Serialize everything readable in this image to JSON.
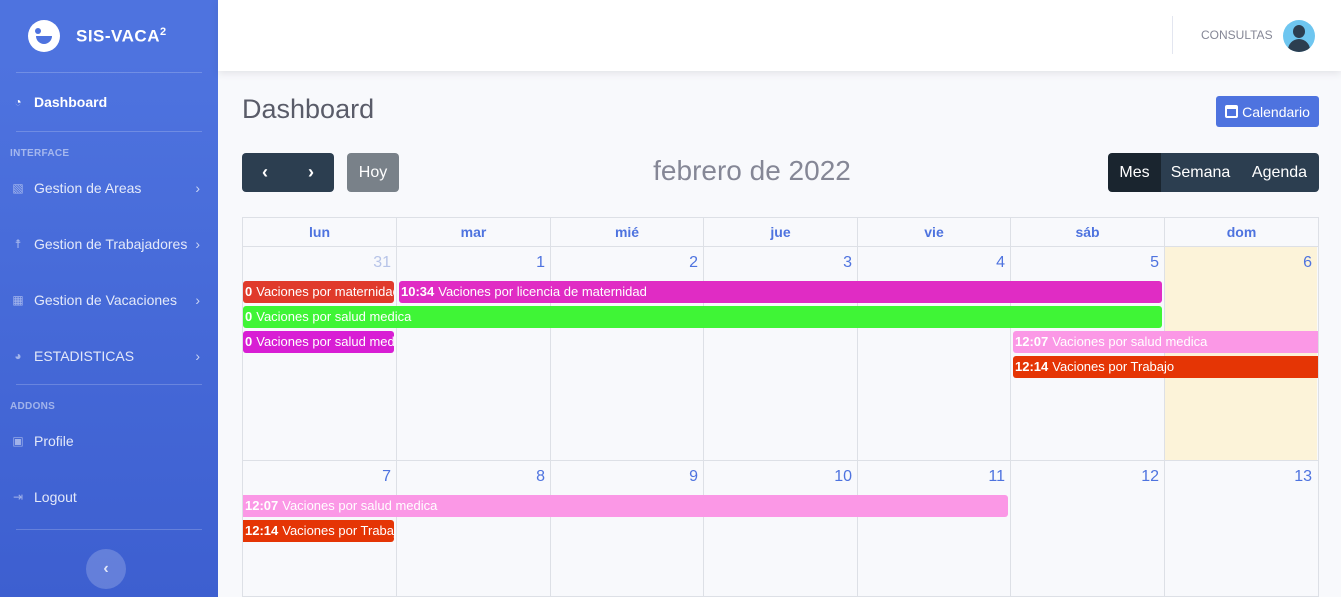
{
  "sidebar": {
    "brand": "SIS-VACA",
    "brand_sup": "2",
    "dashboard": "Dashboard",
    "heading_interface": "INTERFACE",
    "areas": "Gestion de Areas",
    "trabajadores": "Gestion de Trabajadores",
    "vacaciones": "Gestion de Vacaciones",
    "estadisticas": "ESTADISTICAS",
    "heading_addons": "ADDONS",
    "profile": "Profile",
    "logout": "Logout"
  },
  "topbar": {
    "user": "CONSULTAS"
  },
  "page": {
    "title": "Dashboard",
    "calendar_button": "Calendario"
  },
  "calendar": {
    "title": "febrero de 2022",
    "today_button": "Hoy",
    "views": [
      "Mes",
      "Semana",
      "Agenda"
    ],
    "active_view": "Mes",
    "weekdays": [
      "lun",
      "mar",
      "mié",
      "jue",
      "vie",
      "sáb",
      "dom"
    ],
    "weeks": [
      {
        "days": [
          "31",
          "1",
          "2",
          "3",
          "4",
          "5",
          "6"
        ]
      },
      {
        "days": [
          "7",
          "8",
          "9",
          "10",
          "11",
          "12",
          "13"
        ]
      }
    ],
    "colors": {
      "red": "#e03a2b",
      "magenta": "#e02cc4",
      "green": "#3ff536",
      "purple": "#d81ed4",
      "pink": "#fb98e6",
      "orange": "#e53505",
      "today_bg": "#fcf3d9"
    },
    "events_week1": [
      {
        "time": "0",
        "title": "Vaciones por maternidad"
      },
      {
        "time": "10:34",
        "title": "Vaciones por licencia de maternidad"
      },
      {
        "time": "0",
        "title": "Vaciones por salud medica"
      },
      {
        "time": "0",
        "title": "Vaciones por salud medica"
      },
      {
        "time": "12:07",
        "title": "Vaciones por salud medica"
      },
      {
        "time": "12:14",
        "title": "Vaciones por Trabajo"
      }
    ],
    "events_week2": [
      {
        "time": "12:07",
        "title": "Vaciones por salud medica"
      },
      {
        "time": "12:14",
        "title": "Vaciones por Trabajo"
      }
    ]
  }
}
